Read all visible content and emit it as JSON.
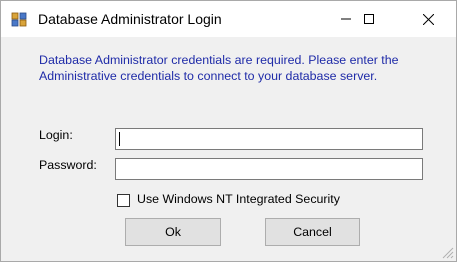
{
  "window": {
    "title": "Database Administrator Login"
  },
  "message": "Database Administrator credentials are required.  Please enter the Administrative credentials to connect to your database server.",
  "form": {
    "login_label": "Login:",
    "login_value": "",
    "password_label": "Password:",
    "password_value": "",
    "integrated_security_label": "Use Windows NT Integrated Security",
    "integrated_security_checked": false
  },
  "buttons": {
    "ok": "Ok",
    "cancel": "Cancel"
  },
  "colors": {
    "message_text": "#1f2ba8",
    "dialog_background": "#f0f0f0",
    "button_background": "#e1e1e1"
  }
}
